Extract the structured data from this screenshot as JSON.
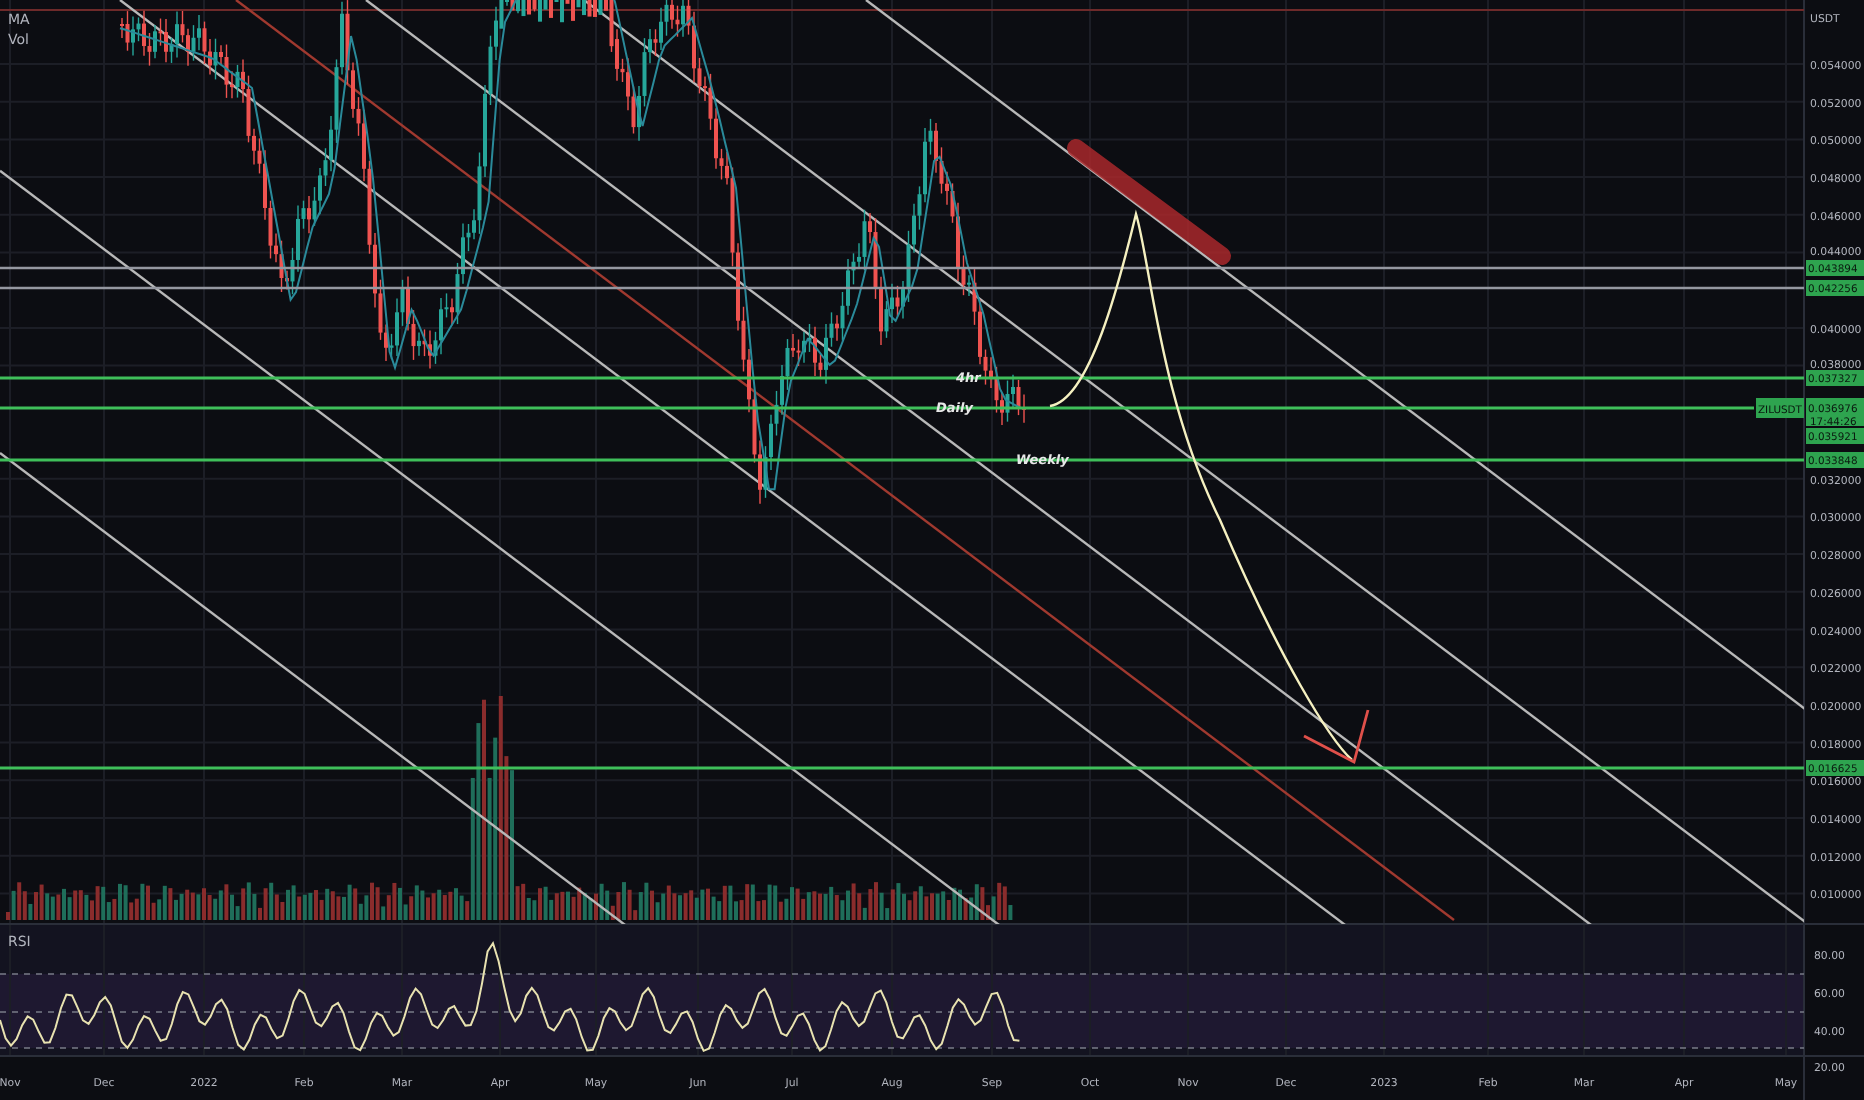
{
  "legend": [
    "MA",
    "Vol"
  ],
  "price_axis": {
    "currency": "USDT",
    "ticks": [
      "0.054000",
      "0.052000",
      "0.050000",
      "0.048000",
      "0.046000",
      "0.044000",
      "0.040000",
      "0.038000",
      "0.032000",
      "0.030000",
      "0.028000",
      "0.026000",
      "0.024000",
      "0.022000",
      "0.020000",
      "0.018000",
      "0.016000",
      "0.014000",
      "0.012000",
      "0.010000"
    ]
  },
  "price_tags": [
    {
      "label": "0.043894",
      "kind": "ref"
    },
    {
      "label": "0.042256",
      "kind": "ref"
    },
    {
      "label": "0.037327",
      "kind": "level"
    },
    {
      "label": "0.035921",
      "kind": "under"
    },
    {
      "label": "0.033848",
      "kind": "level"
    },
    {
      "label": "0.016625",
      "kind": "level"
    }
  ],
  "last_price": {
    "symbol": "ZILUSDT",
    "price": "0.036976",
    "countdown": "17:44:26"
  },
  "annotations": [
    "4hr",
    "Daily",
    "Weekly"
  ],
  "rsi": {
    "label": "RSI",
    "ticks": [
      "80.00",
      "60.00",
      "40.00",
      "20.00"
    ]
  },
  "time_axis": [
    "Nov",
    "Dec",
    "2022",
    "Feb",
    "Mar",
    "Apr",
    "May",
    "Jun",
    "Jul",
    "Aug",
    "Sep",
    "Oct",
    "Nov",
    "Dec",
    "2023",
    "Feb",
    "Mar",
    "Apr",
    "May"
  ]
}
